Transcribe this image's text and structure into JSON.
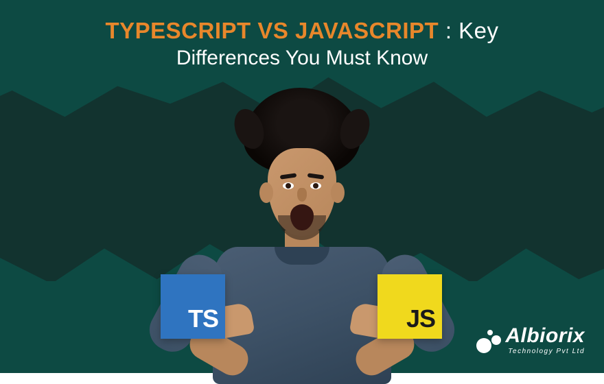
{
  "title": {
    "highlight": "TYPESCRIPT VS JAVASCRIPT",
    "separator": " : ",
    "plain1": "Key",
    "line2": "Differences You Must Know"
  },
  "cards": {
    "ts": "TS",
    "js": "JS"
  },
  "brand": {
    "name": "Albiorix",
    "sub": "Technology Pvt Ltd"
  },
  "colors": {
    "accent_orange": "#e8872b",
    "bg_teal": "#0d4a43",
    "ts_blue": "#2f74c0",
    "js_yellow": "#f0d91d"
  }
}
